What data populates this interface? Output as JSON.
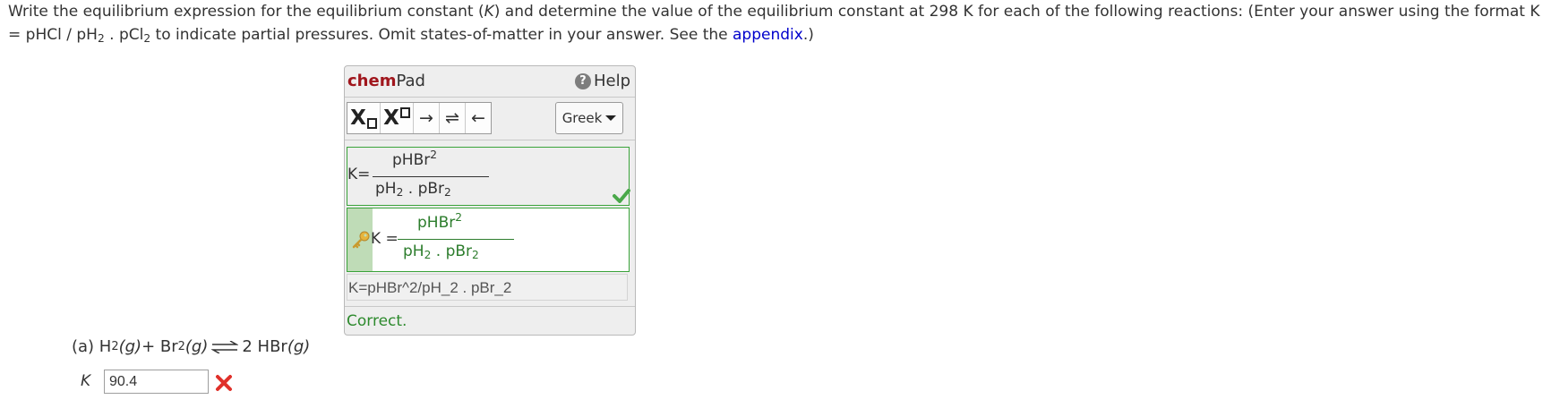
{
  "instructions": {
    "part1": "Write the equilibrium expression for the equilibrium constant (",
    "k_symbol": "K",
    "part2": ") and determine the value of the equilibrium constant at 298 K for each of the following reactions: (Enter your answer using the format K = pHCl / pH",
    "sub2a": "2",
    "part3": " . pCl",
    "sub2b": "2",
    "part4": " to indicate partial pressures. Omit states-of-matter in your answer. See the ",
    "link": "appendix",
    "part5": ".)"
  },
  "chempad": {
    "title_bold": "chem",
    "title_rest": "Pad",
    "help": "Help",
    "help_icon": "question-icon",
    "toolbar": {
      "subscript": "X",
      "superscript": "X",
      "arrow_right": "→",
      "arrow_eq": "⇌",
      "arrow_left": "←"
    },
    "greek": "Greek",
    "answer": {
      "k": "K=",
      "num": "pHBr",
      "num_sup": "2",
      "den1": "pH",
      "den1_sub": "2",
      "den_dot": " . ",
      "den2": "pBr",
      "den2_sub": "2"
    },
    "key": {
      "k": "K =",
      "num": "pHBr",
      "num_sup": "2",
      "den1": "pH",
      "den1_sub": "2",
      "den_dot": " . ",
      "den2": "pBr",
      "den2_sub": "2"
    },
    "raw": "K=pHBr^2/pH_2 . pBr_2",
    "status": "Correct."
  },
  "question": {
    "label": "(a) H",
    "h2_sub": "2",
    "g1": "(g)",
    "plus": " + Br",
    "br2_sub": "2",
    "g2": "(g)",
    "product": "2 HBr",
    "g3": "(g)",
    "k_label": "K",
    "k_value": "90.4"
  },
  "colors": {
    "brand": "#a0161d",
    "correct": "#2d8a2d",
    "wrong": "#e0302a",
    "link": "#0000cc"
  }
}
